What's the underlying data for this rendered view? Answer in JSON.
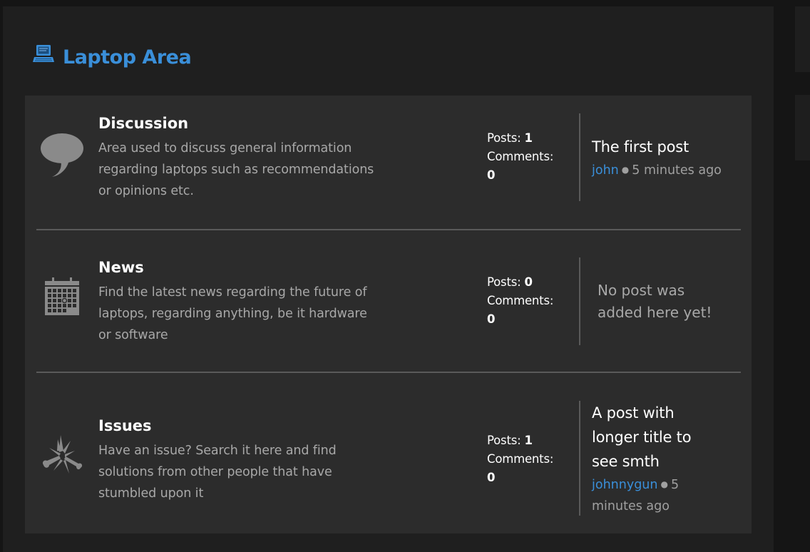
{
  "area": {
    "title": "Laptop Area",
    "icon": "laptop-icon",
    "accent_color": "#3a8fd9"
  },
  "categories": [
    {
      "icon": "speech-bubble-icon",
      "title": "Discussion",
      "description": "Area used to discuss general information regarding laptops such as recommendations or opinions etc.",
      "posts_label": "Posts:",
      "posts": "1",
      "comments_label": "Comments:",
      "comments": "0",
      "latest": {
        "title": "The first post",
        "author": "john",
        "time": "5 minutes ago"
      }
    },
    {
      "icon": "calendar-icon",
      "title": "News",
      "description": "Find the latest news regarding the future of laptops, regarding anything, be it hardware or software",
      "posts_label": "Posts:",
      "posts": "0",
      "comments_label": "Comments:",
      "comments": "0",
      "empty_message": "No post was added here yet!"
    },
    {
      "icon": "broken-bone-icon",
      "title": "Issues",
      "description": "Have an issue? Search it here and find solutions from other people that have stumbled upon it",
      "posts_label": "Posts:",
      "posts": "1",
      "comments_label": "Comments:",
      "comments": "0",
      "latest": {
        "title": "A post with longer title to see smth",
        "author": "johnnygun",
        "time": "5 minutes ago"
      }
    }
  ]
}
